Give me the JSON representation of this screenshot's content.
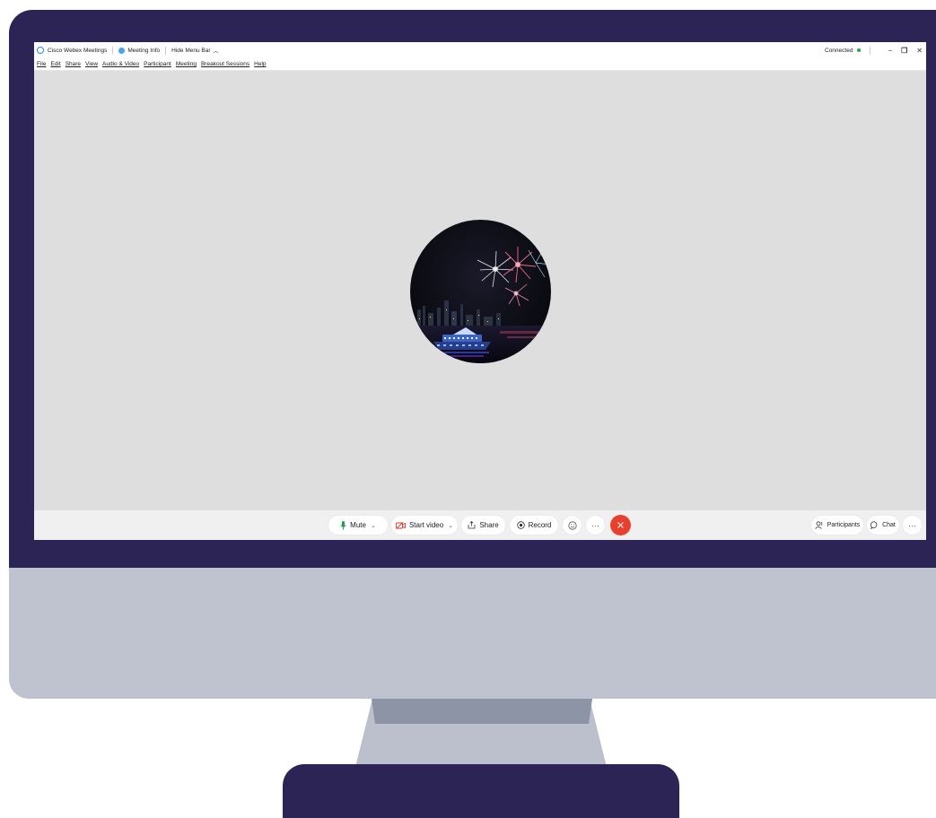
{
  "titlebar": {
    "app_title": "Cisco Webex Meetings",
    "meeting_info": "Meeting Info",
    "hide_menu_bar": "Hide Menu Bar",
    "status": "Connected"
  },
  "menu": {
    "items": [
      "File",
      "Edit",
      "Share",
      "View",
      "Audio & Video",
      "Participant",
      "Meeting",
      "Breakout Sessions",
      "Help"
    ]
  },
  "controls": {
    "mute": "Mute",
    "start_video": "Start video",
    "share": "Share",
    "record": "Record",
    "more": "···",
    "participants": "Participants",
    "chat": "Chat"
  },
  "colors": {
    "accent": "#1e88e5",
    "connected": "#27a844",
    "end_call": "#e8402e",
    "monitor_frame": "#2b2455"
  }
}
